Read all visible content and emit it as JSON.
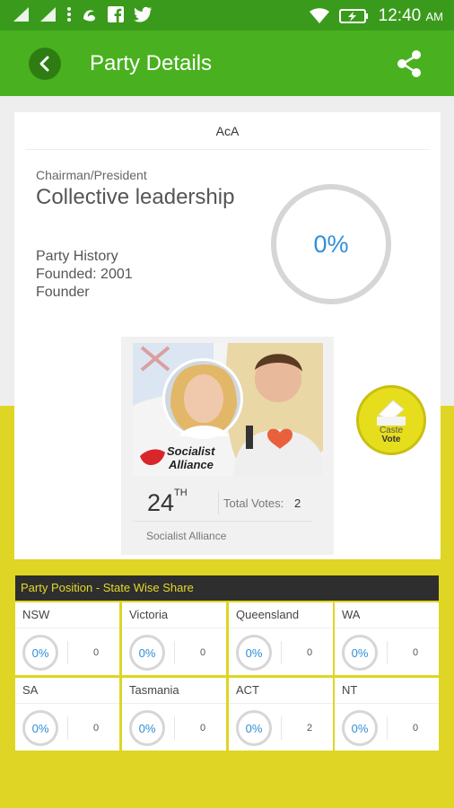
{
  "status_bar": {
    "time": "12:40",
    "ampm": "AM",
    "icons": [
      "signal-icon",
      "signal-icon",
      "more-icon",
      "uc-browser-icon",
      "facebook-icon",
      "twitter-icon",
      "wifi-icon",
      "battery-charging-icon"
    ]
  },
  "app_bar": {
    "title": "Party Details",
    "back_icon": "back-arrow-icon",
    "share_icon": "share-icon"
  },
  "party": {
    "abbreviation": "AcA",
    "chairman_label": "Chairman/President",
    "chairman_name": "Collective leadership",
    "history_label": "Party History",
    "founded": "Founded: 2001",
    "founder": "Founder",
    "vote_share": "0%",
    "rank": "24",
    "rank_suffix": "TH",
    "total_votes_label": "Total Votes:",
    "total_votes": "2",
    "name": "Socialist Alliance",
    "logo_line1": "Socialist",
    "logo_line2": "Alliance"
  },
  "vote_button": {
    "line1": "Caste",
    "line2": "Vote"
  },
  "states_section": {
    "title": "Party Position - State Wise Share",
    "states": [
      {
        "name": "NSW",
        "share": "0%",
        "votes": "0"
      },
      {
        "name": "Victoria",
        "share": "0%",
        "votes": "0"
      },
      {
        "name": "Queensland",
        "share": "0%",
        "votes": "0"
      },
      {
        "name": "WA",
        "share": "0%",
        "votes": "0"
      },
      {
        "name": "SA",
        "share": "0%",
        "votes": "0"
      },
      {
        "name": "Tasmania",
        "share": "0%",
        "votes": "0"
      },
      {
        "name": "ACT",
        "share": "0%",
        "votes": "2"
      },
      {
        "name": "NT",
        "share": "0%",
        "votes": "0"
      }
    ]
  },
  "colors": {
    "status_bar": "#3a9a1c",
    "app_bar": "#49b11f",
    "accent_yellow": "#dfd524",
    "percent_blue": "#2f8fd8",
    "section_header": "#2e2e2e"
  }
}
